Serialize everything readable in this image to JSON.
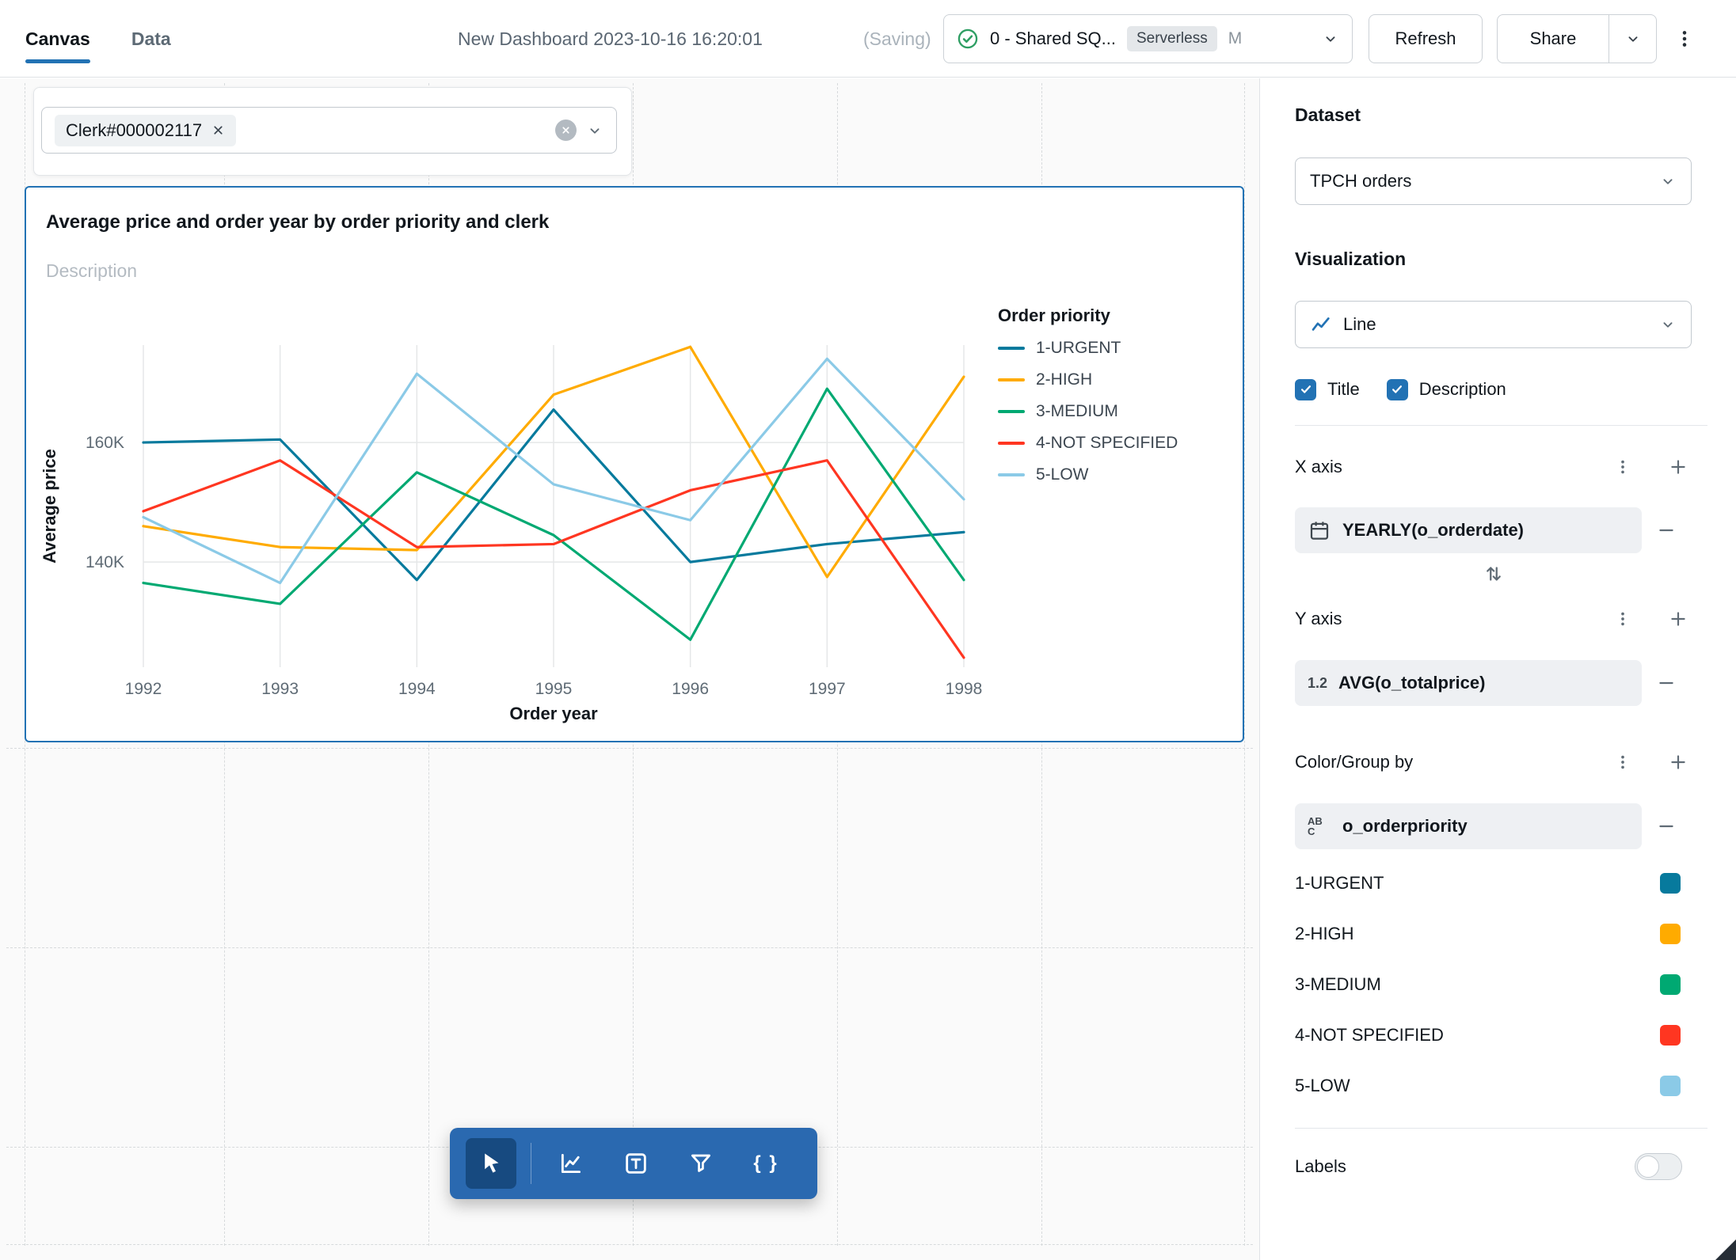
{
  "topbar": {
    "tabs": [
      {
        "label": "Canvas",
        "active": true
      },
      {
        "label": "Data",
        "active": false
      }
    ],
    "title": "New Dashboard 2023-10-16 16:20:01",
    "saving_indicator": "(Saving)",
    "warehouse_selector": {
      "status": "running",
      "name": "0 - Shared SQ...",
      "badge": "Serverless",
      "size": "M"
    },
    "refresh_label": "Refresh",
    "share_label": "Share"
  },
  "canvas": {
    "filter_widget": {
      "chip_label": "Clerk#000002117"
    },
    "chart_widget": {
      "title": "Average price and order year by order priority and clerk",
      "description_placeholder": "Description"
    },
    "toolbar": {
      "tools": [
        "select",
        "add-visualization",
        "add-text",
        "add-filter",
        "add-code"
      ],
      "code_glyph": "{ }"
    }
  },
  "chart_data": {
    "type": "line",
    "title": "Average price and order year by order priority and clerk",
    "xlabel": "Order year",
    "ylabel": "Average price",
    "legend_title": "Order priority",
    "legend_position": "right",
    "grid": "both",
    "x": [
      1992,
      1993,
      1994,
      1995,
      1996,
      1997,
      1998
    ],
    "ylim": [
      122400,
      176300
    ],
    "yticks": [
      {
        "value": 160000,
        "label": "160K"
      },
      {
        "value": 140000,
        "label": "140K"
      }
    ],
    "series": [
      {
        "name": "1-URGENT",
        "color": "#077A9D",
        "values": [
          160000,
          160500,
          137000,
          165500,
          140000,
          143000,
          145000
        ]
      },
      {
        "name": "2-HIGH",
        "color": "#FFAB00",
        "values": [
          146000,
          142500,
          142000,
          168000,
          176000,
          137500,
          171000
        ]
      },
      {
        "name": "3-MEDIUM",
        "color": "#00A972",
        "values": [
          136500,
          133000,
          155000,
          144500,
          127000,
          169000,
          137000
        ]
      },
      {
        "name": "4-NOT SPECIFIED",
        "color": "#FF3621",
        "values": [
          148500,
          157000,
          142500,
          143000,
          152000,
          157000,
          124000
        ]
      },
      {
        "name": "5-LOW",
        "color": "#8BCAE7",
        "values": [
          147500,
          136500,
          171500,
          153000,
          147000,
          174000,
          150500
        ]
      }
    ]
  },
  "sidebar": {
    "dataset": {
      "label": "Dataset",
      "value": "TPCH orders"
    },
    "visualization": {
      "label": "Visualization",
      "value": "Line"
    },
    "checkboxes": [
      {
        "label": "Title",
        "checked": true
      },
      {
        "label": "Description",
        "checked": true
      }
    ],
    "x_axis": {
      "label": "X axis",
      "field": "YEARLY(o_orderdate)"
    },
    "y_axis": {
      "label": "Y axis",
      "field": "AVG(o_totalprice)",
      "icon_glyph": "1.2"
    },
    "color_group": {
      "label": "Color/Group by",
      "field": "o_orderpriority",
      "icon_glyph": "AB\nC"
    },
    "labels": {
      "label": "Labels",
      "enabled": false
    }
  },
  "icons": [
    "check-circle-icon",
    "chevron-down-icon",
    "kebab-menu-icon",
    "close-icon",
    "clear-circle-icon",
    "calendar-icon",
    "numeric-field-icon",
    "string-field-icon",
    "swap-axes-icon",
    "plus-icon",
    "minus-icon",
    "cursor-icon",
    "line-chart-icon",
    "text-tool-icon",
    "funnel-icon",
    "braces-icon",
    "toggle-icon"
  ]
}
